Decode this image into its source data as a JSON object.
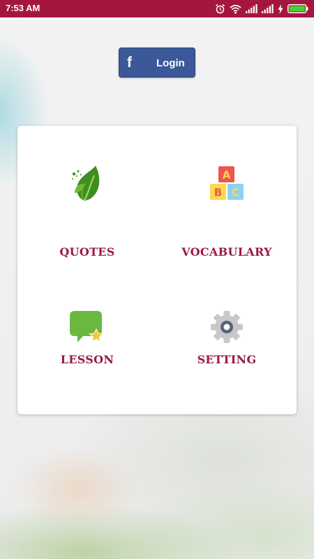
{
  "status_bar": {
    "time": "7:53 AM",
    "icons": [
      "alarm-icon",
      "wifi-icon",
      "signal-icon",
      "signal-icon",
      "charging-icon",
      "battery-icon"
    ],
    "color": "#a3173f"
  },
  "login": {
    "icon": "facebook-icon",
    "label": "Login",
    "color": "#3b5998"
  },
  "menu": {
    "label_color": "#9c1a3f",
    "items": [
      {
        "label": "QUOTES",
        "icon": "leaf-icon"
      },
      {
        "label": "VOCABULARY",
        "icon": "abc-blocks-icon"
      },
      {
        "label": "LESSON",
        "icon": "chat-star-icon"
      },
      {
        "label": "SETTING",
        "icon": "gear-icon"
      }
    ]
  }
}
